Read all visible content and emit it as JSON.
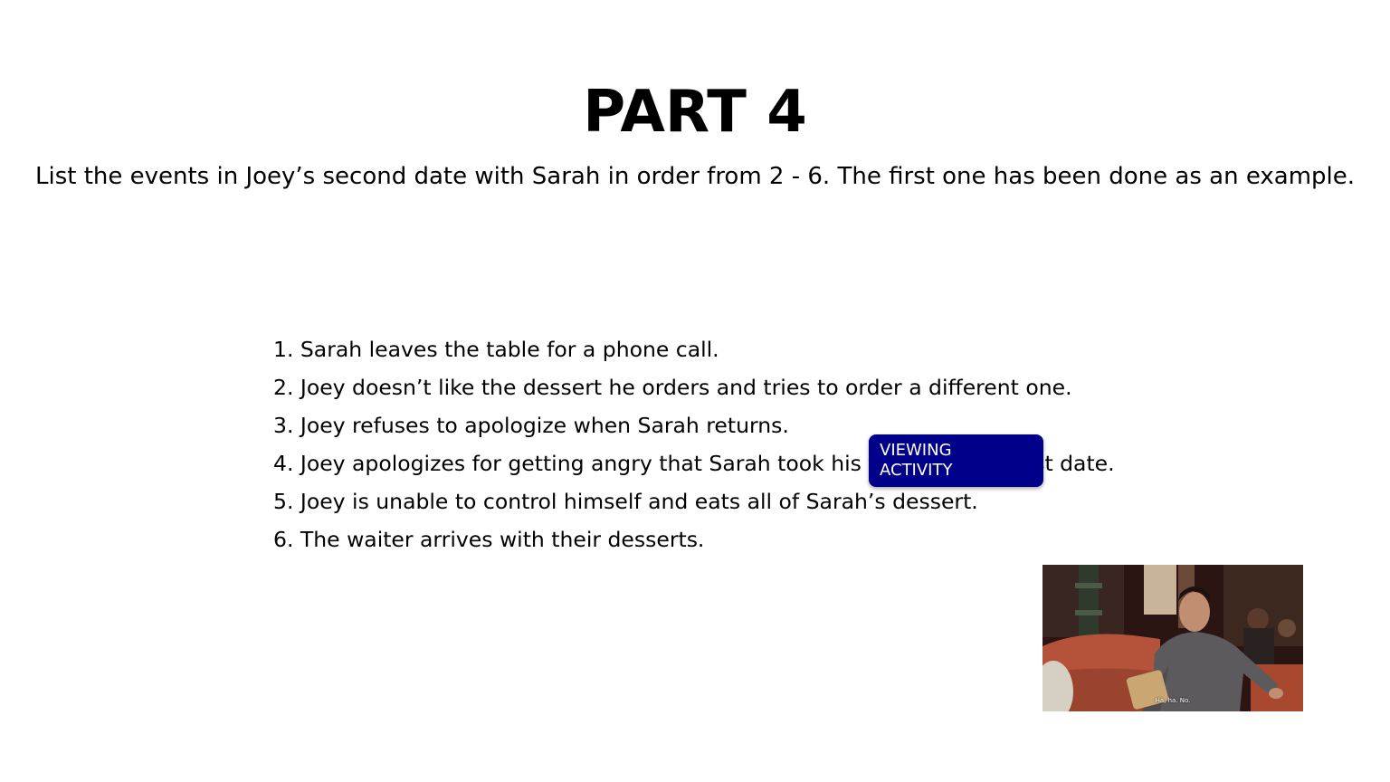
{
  "slide": {
    "title": "PART 4",
    "instructions": "List the events in Joey’s second date with Sarah in order from 2 - 6. The first one has been done as an example."
  },
  "events": [
    "1. Sarah leaves the table for a phone call.",
    "2. Joey doesn’t like the dessert he orders and tries to order a different one.",
    "3. Joey refuses to apologize when Sarah returns.",
    "4. Joey apologizes for getting angry that Sarah took his food on their first date.",
    "5. Joey is unable to control himself and eats all of Sarah’s dessert.",
    "6. The waiter arrives with their desserts."
  ],
  "badge": {
    "line1": "VIEWING",
    "line2": "ACTIVITY",
    "color": "#00008b"
  },
  "video": {
    "subtitle": "Ha, ha. No."
  }
}
